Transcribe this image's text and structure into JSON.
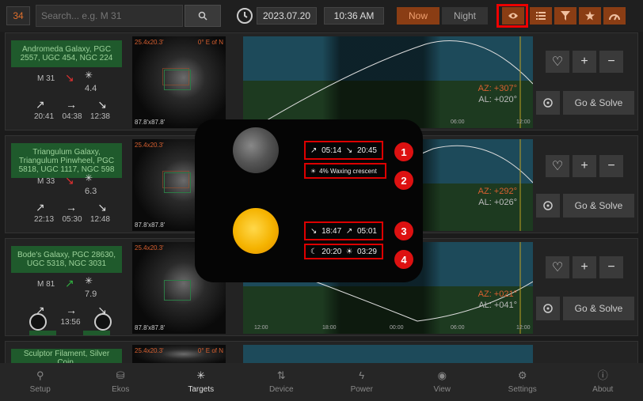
{
  "topbar": {
    "count": "34",
    "search_placeholder": "Search... e.g. M 31",
    "date": "2023.07.20",
    "time": "10:36 AM",
    "now_label": "Now",
    "night_label": "Night"
  },
  "targets": [
    {
      "name": "Andromeda Galaxy, PGC 2557, UGC 454, NGC 224",
      "messier": "M 31",
      "magnitude": "4.4",
      "trend_color": "#e03030",
      "rise": "20:41",
      "transit": "04:38",
      "set": "12:38",
      "fov": "25.4x20.3'",
      "pa": "0° E of N",
      "size": "87.8'x87.8'",
      "az": "AZ: +307°",
      "al": "AL: +020°",
      "go_label": "Go & Solve"
    },
    {
      "name": "Triangulum Galaxy, Triangulum Pinwheel, PGC 5818, UGC 1117, NGC 598",
      "messier": "M 33",
      "magnitude": "6.3",
      "trend_color": "#e03030",
      "rise": "22:13",
      "transit": "05:30",
      "set": "12:48",
      "fov": "25.4x20.3'",
      "pa": "",
      "size": "87.8'x87.8'",
      "az": "AZ: +292°",
      "al": "AL: +026°",
      "go_label": "Go & Solve"
    },
    {
      "name": "Bode's Galaxy, PGC 28630, UGC 5318, NGC 3031",
      "messier": "M 81",
      "magnitude": "7.9",
      "trend_color": "#30b040",
      "rise": "",
      "transit": "13:56",
      "set": "",
      "fov": "25.4x20.3'",
      "pa": "",
      "size": "87.8'x87.8'",
      "az": "AZ: +021°",
      "al": "AL: +041°",
      "go_label": "Go & Solve"
    },
    {
      "name": "Sculptor Filament, Silver Coin,",
      "fov": "25.4x20.3'",
      "pa": "0° E of N"
    }
  ],
  "plot_ticks": [
    "12:00",
    "18:00",
    "00:00",
    "06:00",
    "12:00"
  ],
  "plot_ylabels": [
    "20",
    "40",
    "60"
  ],
  "popup": {
    "moon_rise": "05:14",
    "moon_set": "20:45",
    "moon_phase": "4% Waxing crescent",
    "sun_set": "18:47",
    "sun_rise": "05:01",
    "dusk": "20:20",
    "dawn": "03:29",
    "badges": [
      "1",
      "2",
      "3",
      "4"
    ]
  },
  "nav": [
    {
      "label": "Setup",
      "icon": "setup-icon"
    },
    {
      "label": "Ekos",
      "icon": "ekos-icon"
    },
    {
      "label": "Targets",
      "icon": "targets-icon"
    },
    {
      "label": "Device",
      "icon": "device-icon"
    },
    {
      "label": "Power",
      "icon": "power-icon"
    },
    {
      "label": "View",
      "icon": "eye-icon"
    },
    {
      "label": "Settings",
      "icon": "gear-icon"
    },
    {
      "label": "About",
      "icon": "info-icon"
    }
  ],
  "colors": {
    "accent": "#8a3d14",
    "highlight": "#e00000",
    "name_bg": "#1f5a2c"
  }
}
